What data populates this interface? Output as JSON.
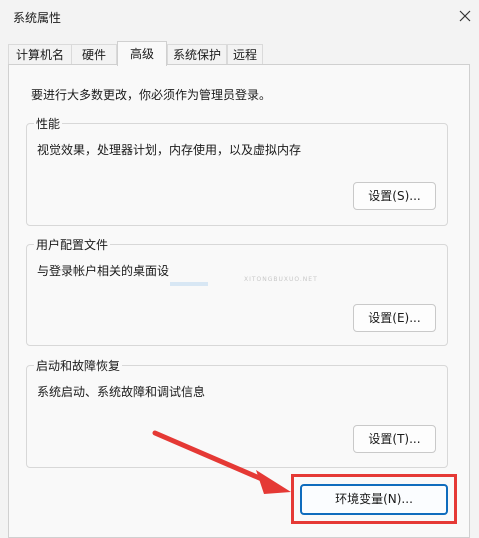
{
  "window": {
    "title": "系统属性"
  },
  "tabs": [
    {
      "label": "计算机名"
    },
    {
      "label": "硬件"
    },
    {
      "label": "高级"
    },
    {
      "label": "系统保护"
    },
    {
      "label": "远程"
    }
  ],
  "notice": "要进行大多数更改，你必须作为管理员登录。",
  "groups": {
    "performance": {
      "title": "性能",
      "description": "视觉效果，处理器计划，内存使用，以及虚拟内存",
      "button": "设置(S)..."
    },
    "user_profiles": {
      "title": "用户配置文件",
      "description": "与登录帐户相关的桌面设",
      "button": "设置(E)..."
    },
    "startup_recovery": {
      "title": "启动和故障恢复",
      "description": "系统启动、系统故障和调试信息",
      "button": "设置(T)..."
    }
  },
  "env_button": "环境变量(N)...",
  "overlay_text": "XITONGBUXUO.NET",
  "colors": {
    "highlight": "#e53935",
    "primary_border": "#0f6cbd"
  }
}
